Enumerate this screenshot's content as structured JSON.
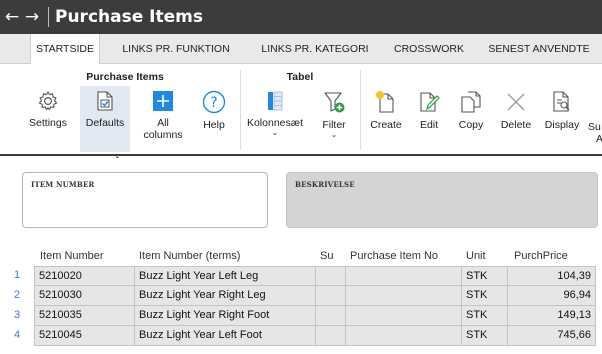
{
  "titlebar": {
    "back_icon": "←",
    "forward_icon": "→",
    "title": "Purchase Items"
  },
  "tabs": [
    {
      "label": "STARTSIDE",
      "active": true
    },
    {
      "label": "LINKS PR. FUNKTION"
    },
    {
      "label": "LINKS PR. KATEGORI"
    },
    {
      "label": "CROSSWORK"
    },
    {
      "label": "SENEST ANVENDTE"
    }
  ],
  "ribbon": {
    "groups": {
      "purchase_items": "Purchase Items",
      "tabel": "Tabel"
    },
    "buttons": {
      "settings": "Settings",
      "defaults": "Defaults",
      "all_columns_1": "All",
      "all_columns_2": "columns",
      "help": "Help",
      "kolonnesaet": "Kolonnesæt",
      "filter": "Filter",
      "create": "Create",
      "edit": "Edit",
      "copy": "Copy",
      "delete": "Delete",
      "display": "Display",
      "cut_1": "Su",
      "cut_2": "A"
    },
    "caret": "⌄",
    "colors": {
      "accent": "#1e88e5",
      "help": "#1e88e5",
      "filter_badge": "#2e9b43",
      "create_dot": "#f5c623"
    }
  },
  "filters": {
    "item_number_label": "ITEM NUMBER",
    "description_label": "BESKRIVELSE"
  },
  "grid": {
    "headers": [
      "Item Number",
      "Item Number (terms)",
      "Su",
      "Purchase Item No",
      "Unit",
      "PurchPrice"
    ],
    "rows": [
      {
        "n": "1",
        "item": "5210020",
        "terms": "Buzz Light Year Left Leg",
        "su": "",
        "pin": "",
        "unit": "STK",
        "price": "104,39"
      },
      {
        "n": "2",
        "item": "5210030",
        "terms": "Buzz Light Year Right Leg",
        "su": "",
        "pin": "",
        "unit": "STK",
        "price": "96,94"
      },
      {
        "n": "3",
        "item": "5210035",
        "terms": "Buzz Light Year Right Foot",
        "su": "",
        "pin": "",
        "unit": "STK",
        "price": "149,13"
      },
      {
        "n": "4",
        "item": "5210045",
        "terms": "Buzz Light Year Left Foot",
        "su": "",
        "pin": "",
        "unit": "STK",
        "price": "745,66"
      }
    ]
  }
}
